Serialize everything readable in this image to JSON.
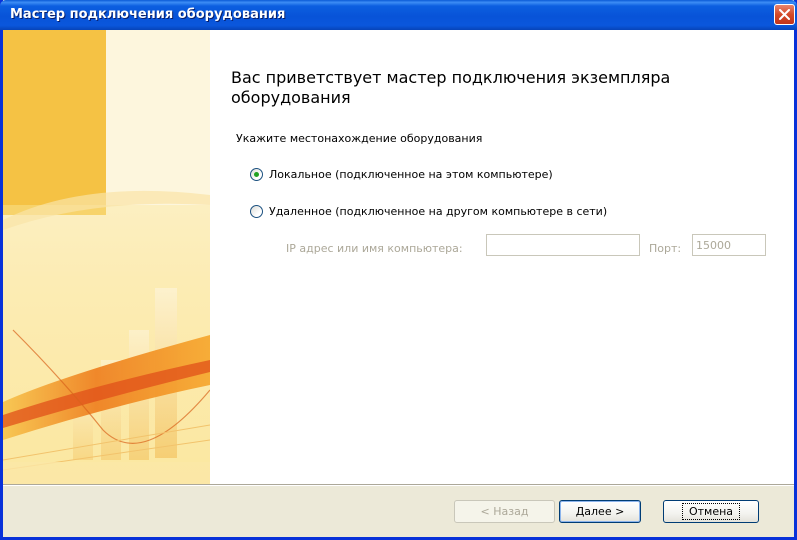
{
  "window": {
    "title": "Мастер подключения оборудования"
  },
  "main": {
    "heading": "Вас приветствует мастер подключения экземпляра оборудования",
    "subheading": "Укажите местонахождение оборудования",
    "options": [
      {
        "label": "Локальное (подключенное на этом компьютере)",
        "checked": true
      },
      {
        "label": "Удаленное (подключенное на другом компьютере в сети)",
        "checked": false
      }
    ],
    "host_label": "IP адрес или имя компьютера:",
    "host_value": "",
    "port_label": "Порт:",
    "port_value": "15000"
  },
  "buttons": {
    "back": "< Назад",
    "next": "Далее >",
    "cancel": "Отмена"
  },
  "colors": {
    "titlebar": "#0853d8",
    "sidebar_accent": "#f2a51a",
    "face": "#ece9d8"
  }
}
